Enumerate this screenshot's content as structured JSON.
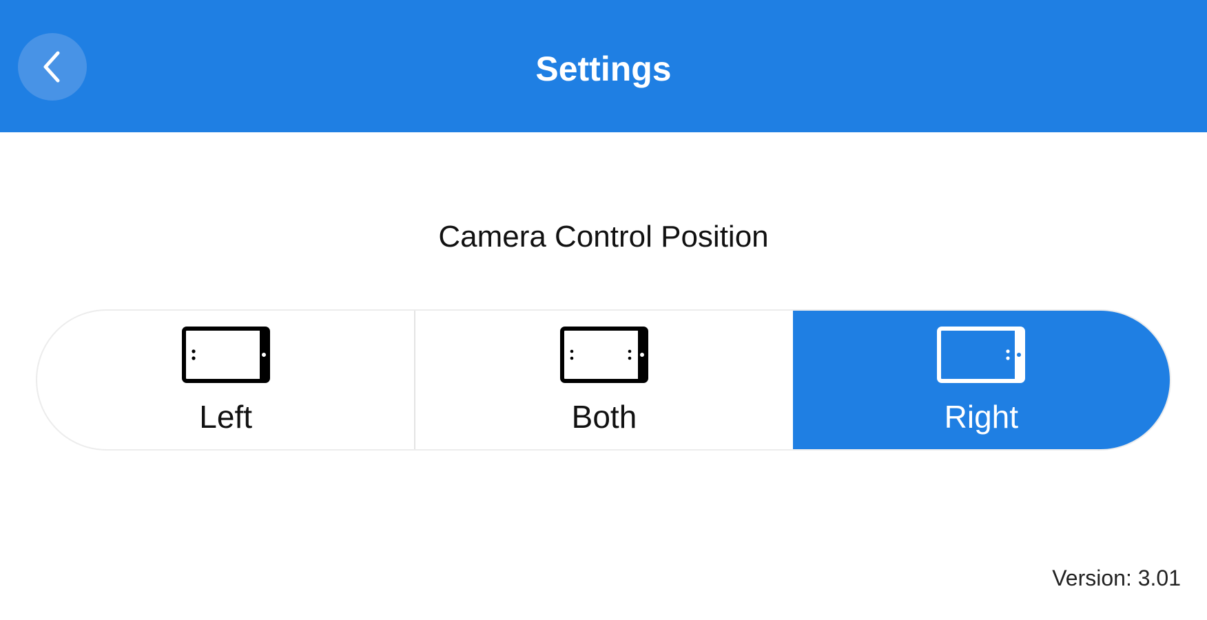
{
  "header": {
    "title": "Settings",
    "back_icon": "chevron-left-icon"
  },
  "camera_control": {
    "title": "Camera Control Position",
    "options": [
      {
        "label": "Left",
        "icon": "tablet-left-control-icon",
        "selected": false
      },
      {
        "label": "Both",
        "icon": "tablet-both-control-icon",
        "selected": false
      },
      {
        "label": "Right",
        "icon": "tablet-right-control-icon",
        "selected": true
      }
    ]
  },
  "footer": {
    "version": "Version: 3.01"
  },
  "colors": {
    "accent": "#1f7fe3",
    "back_button_bg": "#4893e6",
    "segment_border": "#ececec",
    "text": "#111111"
  }
}
